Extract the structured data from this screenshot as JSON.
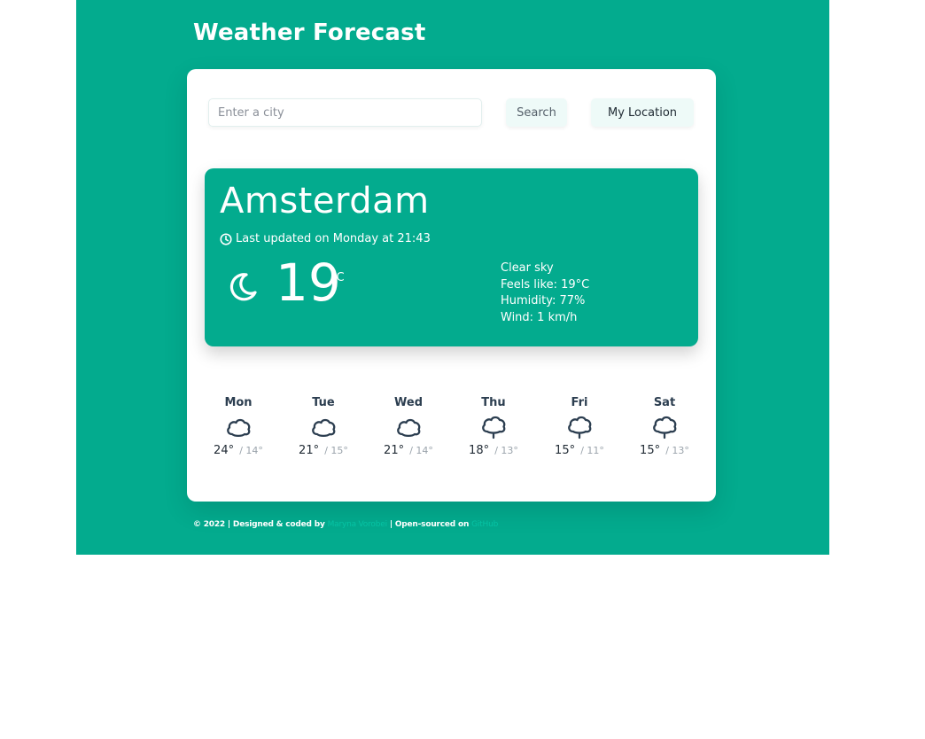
{
  "header": {
    "title": "Weather Forecast"
  },
  "search": {
    "placeholder": "Enter a city",
    "value": "",
    "search_label": "Search",
    "location_label": "My Location"
  },
  "current": {
    "city": "Amsterdam",
    "updated": "Last updated on Monday at 21:43",
    "icon": "night-crescent-icon",
    "temperature": "19",
    "unit": "°C",
    "description": "Clear sky",
    "feels_like": "Feels like: 19°C",
    "humidity": "Humidity: 77%",
    "wind": "Wind: 1 km/h"
  },
  "forecast": [
    {
      "day": "Mon",
      "max": "24°",
      "min": "/ 14°",
      "icon": "cloud-icon"
    },
    {
      "day": "Tue",
      "max": "21°",
      "min": "/ 15°",
      "icon": "cloud-icon"
    },
    {
      "day": "Wed",
      "max": "21°",
      "min": "/ 14°",
      "icon": "cloud-icon"
    },
    {
      "day": "Thu",
      "max": "18°",
      "min": "/ 13°",
      "icon": "rain-cloud-icon"
    },
    {
      "day": "Fri",
      "max": "15°",
      "min": "/ 11°",
      "icon": "rain-cloud-icon"
    },
    {
      "day": "Sat",
      "max": "15°",
      "min": "/ 13°",
      "icon": "rain-cloud-icon"
    }
  ],
  "footer": {
    "prefix": "© 2022 | Designed & coded by",
    "author": "Maryna Vorobei",
    "middle": "| Open-sourced on",
    "repo": "GitHub"
  },
  "colors": {
    "brand": "#03ab8e",
    "link": "#06c3a4",
    "forecast_icon": "#2c3e50"
  }
}
